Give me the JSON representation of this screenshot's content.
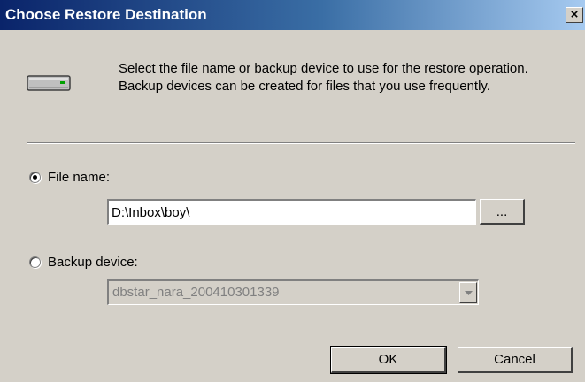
{
  "window": {
    "title": "Choose Restore Destination",
    "close_label": "×"
  },
  "intro": {
    "icon": "drive-icon",
    "text": "Select the file name or backup device to use for the restore operation.  Backup devices can be created for files that you use frequently."
  },
  "file_name": {
    "label": "File name:",
    "selected": true,
    "value": "D:\\Inbox\\boy\\",
    "browse_label": "..."
  },
  "backup_device": {
    "label": "Backup device:",
    "selected": false,
    "value": "dbstar_nara_200410301339",
    "disabled": true
  },
  "buttons": {
    "ok": "OK",
    "cancel": "Cancel"
  }
}
